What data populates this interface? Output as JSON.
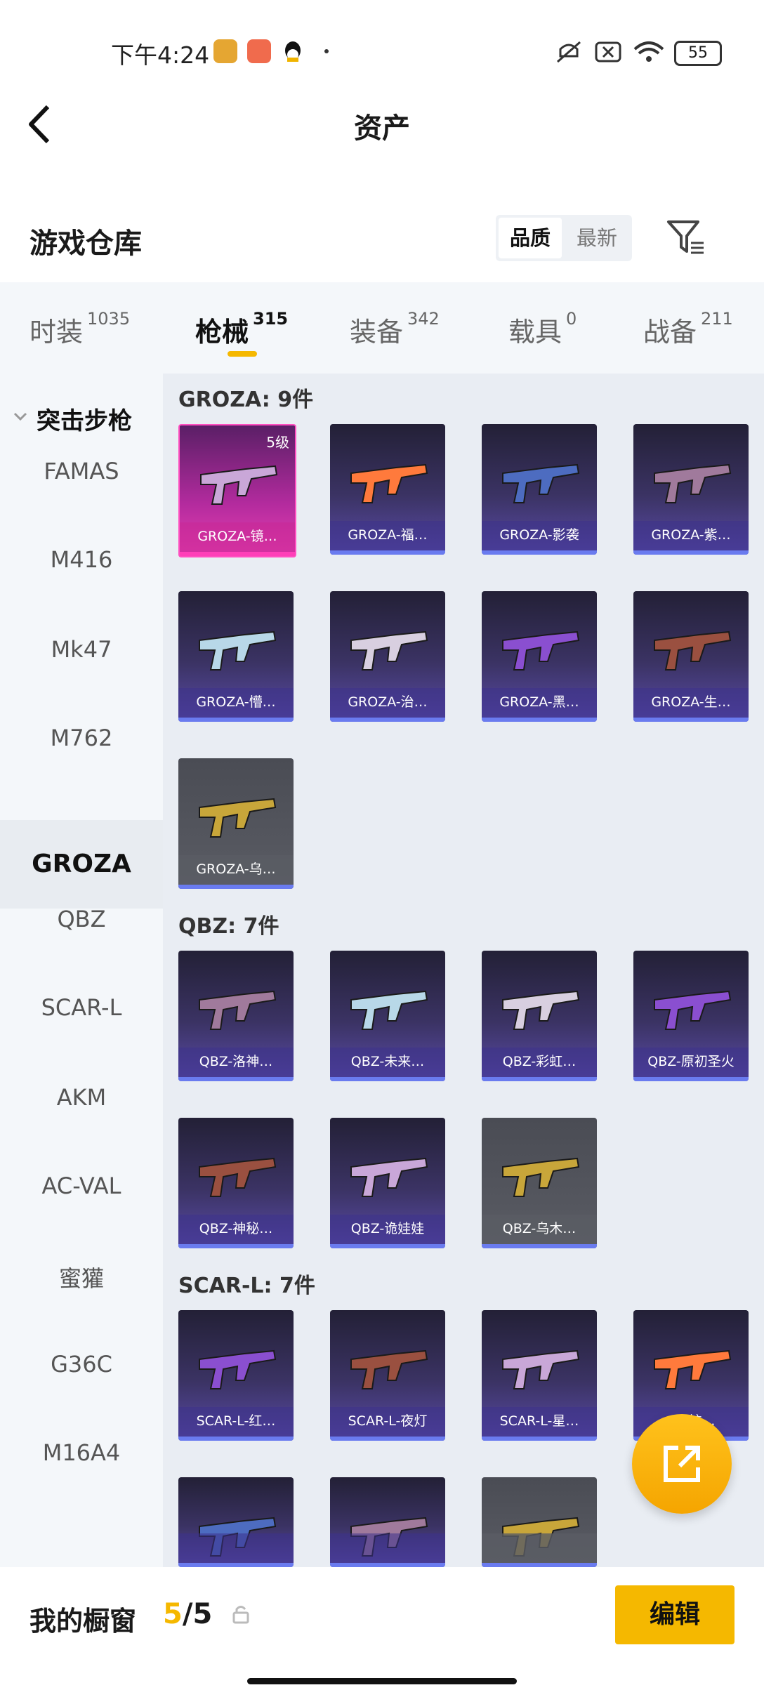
{
  "status_bar": {
    "time": "下午4:24",
    "battery": "55",
    "colors": {
      "app1": "#e5a632",
      "app2": "#f06b4d"
    }
  },
  "header": {
    "title": "资产",
    "back_icon": "chevron-left-icon"
  },
  "warehouse": {
    "title": "游戏仓库",
    "sort": {
      "quality": "品质",
      "newest": "最新",
      "selected": "品质"
    },
    "filter_icon": "filter-icon"
  },
  "tabs": [
    {
      "label": "时装",
      "count": "1035"
    },
    {
      "label": "枪械",
      "count": "315",
      "active": true
    },
    {
      "label": "装备",
      "count": "342"
    },
    {
      "label": "载具",
      "count": "0"
    },
    {
      "label": "战备",
      "count": "211"
    }
  ],
  "sidebar": {
    "category": "突击步枪",
    "items": [
      "FAMAS",
      "M416",
      "Mk47",
      "M762",
      "GROZA",
      "QBZ",
      "SCAR-L",
      "AKM",
      "AC-VAL",
      "蜜獾",
      "G36C",
      "M16A4"
    ],
    "active": "GROZA"
  },
  "sections": [
    {
      "title": "GROZA: 9件",
      "items": [
        {
          "name": "GROZA-镜…",
          "level": "5级",
          "style": "pink"
        },
        {
          "name": "GROZA-福…"
        },
        {
          "name": "GROZA-影袭"
        },
        {
          "name": "GROZA-紫…"
        },
        {
          "name": "GROZA-懵…"
        },
        {
          "name": "GROZA-治…"
        },
        {
          "name": "GROZA-黑…"
        },
        {
          "name": "GROZA-生…"
        },
        {
          "name": "GROZA-乌…",
          "style": "grey"
        }
      ]
    },
    {
      "title": "QBZ: 7件",
      "items": [
        {
          "name": "QBZ-洛神…"
        },
        {
          "name": "QBZ-未来…"
        },
        {
          "name": "QBZ-彩虹…"
        },
        {
          "name": "QBZ-原初圣火"
        },
        {
          "name": "QBZ-神秘…"
        },
        {
          "name": "QBZ-诡娃娃"
        },
        {
          "name": "QBZ-乌木…",
          "style": "grey"
        }
      ]
    },
    {
      "title": "SCAR-L: 7件",
      "items": [
        {
          "name": "SCAR-L-红…"
        },
        {
          "name": "SCAR-L-夜灯"
        },
        {
          "name": "SCAR-L-星…"
        },
        {
          "name": "S…炫…"
        },
        {
          "name": ""
        },
        {
          "name": ""
        },
        {
          "name": "",
          "style": "grey"
        }
      ]
    }
  ],
  "bottom": {
    "label": "我的橱窗",
    "used": "5",
    "total": "/5",
    "edit": "编辑",
    "lock_icon": "lock-icon"
  },
  "fab": {
    "icon": "share-external-icon"
  }
}
